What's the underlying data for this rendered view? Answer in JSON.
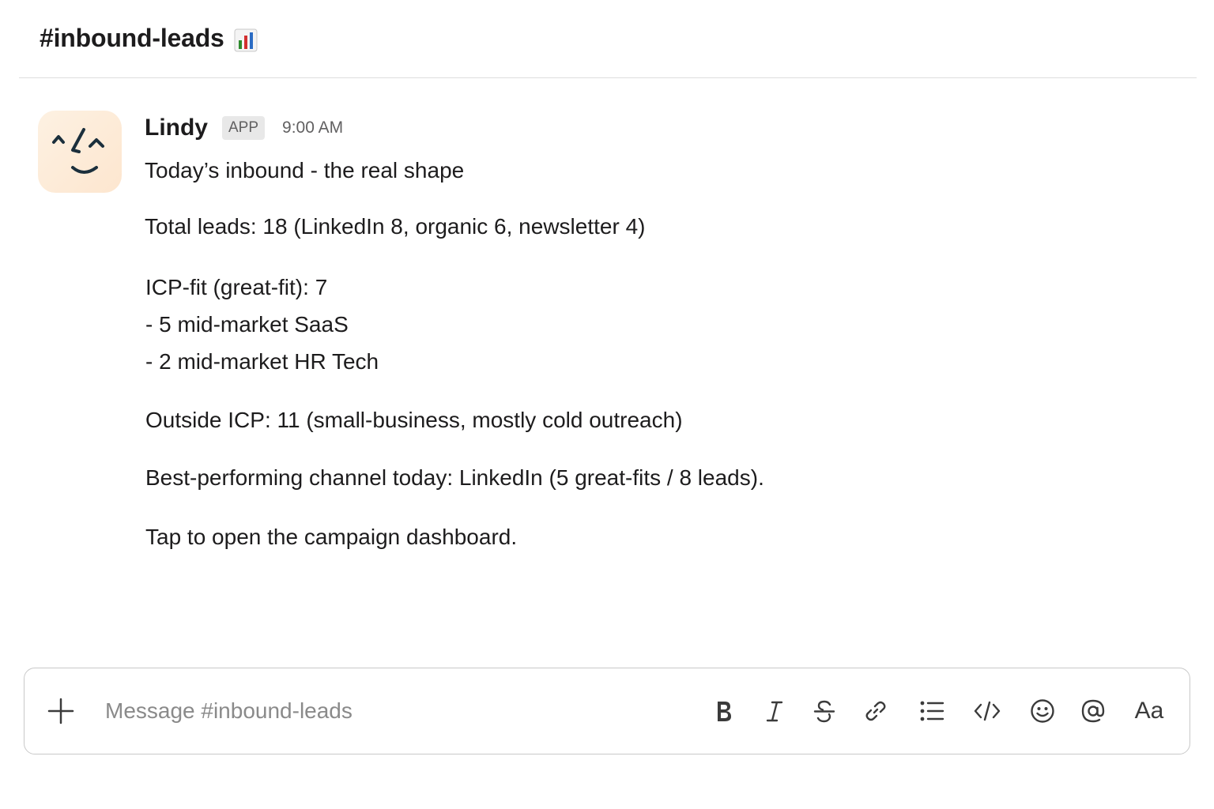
{
  "channel": {
    "title": "#inbound-leads",
    "title_icon": "bar-chart-emoji"
  },
  "message": {
    "sender": "Lindy",
    "badge": "APP",
    "time": "9:00 AM",
    "avatar_icon": "lindy-face-icon",
    "lines": {
      "headline": "Today’s inbound - the real shape",
      "total": "Total leads: 18 (LinkedIn 8, organic 6, newsletter 4)",
      "icp_fit": "ICP-fit (great-fit): 7",
      "bullet_1": "-  5 mid-market SaaS",
      "bullet_2": "-  2 mid-market HR Tech",
      "outside_icp": "Outside ICP: 11 (small-business, mostly cold outreach)",
      "best_channel": "Best-performing channel today: LinkedIn (5 great-fits / 8 leads).",
      "cta": "Tap to open the campaign dashboard."
    }
  },
  "composer": {
    "placeholder": "Message #inbound-leads",
    "font_toggle_label": "Aa",
    "icons": [
      "plus-icon",
      "bold-icon",
      "italic-icon",
      "strikethrough-icon",
      "link-icon",
      "bulleted-list-icon",
      "code-icon",
      "emoji-icon",
      "mention-icon",
      "text-formatting-icon"
    ]
  },
  "colors": {
    "text": "#1d1c1d",
    "muted": "#616061",
    "avatar_bg": "#fde6cf",
    "avatar_ink": "#1b2f3c"
  }
}
